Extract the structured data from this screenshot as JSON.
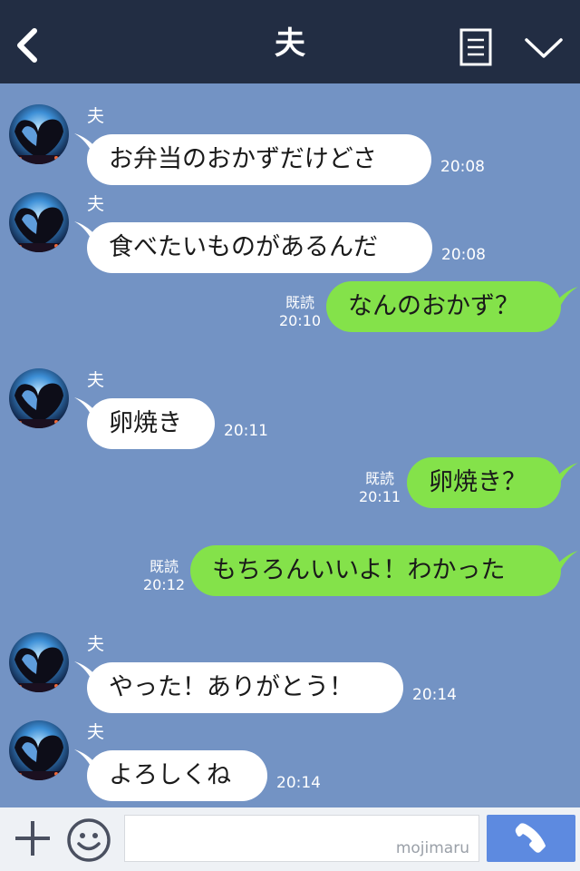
{
  "header": {
    "title": "夫"
  },
  "messages": [
    {
      "type": "in",
      "sender": "夫",
      "text": "お弁当のおかずだけどさ",
      "time": "20:08"
    },
    {
      "type": "in",
      "sender": "夫",
      "text": "食べたいものがあるんだ",
      "time": "20:08"
    },
    {
      "type": "out",
      "text": "なんのおかず？",
      "read": "既読",
      "time": "20:10"
    },
    {
      "type": "in",
      "sender": "夫",
      "text": "卵焼き",
      "time": "20:11"
    },
    {
      "type": "out",
      "text": "卵焼き？",
      "read": "既読",
      "time": "20:11"
    },
    {
      "type": "out",
      "text": "もちろんいいよ！わかった",
      "read": "既読",
      "time": "20:12"
    },
    {
      "type": "in",
      "sender": "夫",
      "text": "やった！ありがとう！",
      "time": "20:14"
    },
    {
      "type": "in",
      "sender": "夫",
      "text": "よろしくね",
      "time": "20:14"
    }
  ],
  "input": {
    "watermark": "mojimaru"
  },
  "icons": {
    "back": "back-chevron-icon",
    "menu": "document-menu-icon",
    "collapse": "chevron-down-icon",
    "plus": "plus-icon",
    "emoji": "smiley-icon",
    "call": "phone-icon"
  },
  "colors": {
    "header": "#222d43",
    "chat_background": "#7393c4",
    "incoming_bubble": "#ffffff",
    "outgoing_bubble": "#84e24a",
    "call_button": "#5d8ae0"
  }
}
